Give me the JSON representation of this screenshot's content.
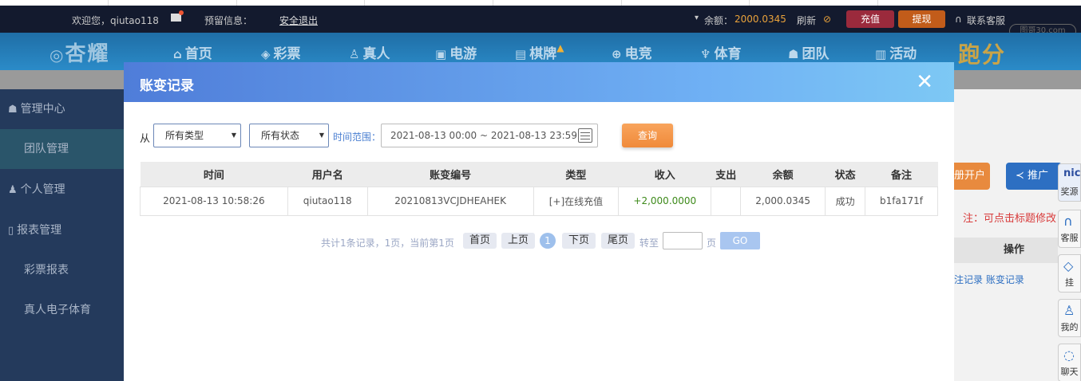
{
  "topbar": {
    "welcome": "欢迎您，qiutao118",
    "reserve_info": "预留信息：",
    "logout": "安全退出",
    "balance_label": "余额：",
    "balance_value": "2000.0345",
    "refresh": "刷新",
    "charge": "充值",
    "withdraw": "提现",
    "support": "联系客服",
    "watermark": "图哥30.com"
  },
  "nav": {
    "logo": "杏耀",
    "items": [
      "首页",
      "彩票",
      "真人",
      "电游",
      "棋牌",
      "电竞",
      "体育",
      "团队",
      "活动"
    ],
    "special": "跑分"
  },
  "sidebar": {
    "items": [
      {
        "label": "管理中心"
      },
      {
        "label": "团队管理"
      },
      {
        "label": "个人管理"
      },
      {
        "label": "报表管理"
      },
      {
        "label": "彩票报表"
      },
      {
        "label": "真人电子体育"
      }
    ]
  },
  "background_panel": {
    "open_account": "册开户",
    "promo": "推广",
    "note": "注：可点击标题修改",
    "op_header": "操作",
    "op_links": "注记录  账变记录",
    "float_items": [
      "奖源",
      "客服",
      "挂",
      "我的",
      "聊天"
    ]
  },
  "modal": {
    "title": "账变记录",
    "close": "✕",
    "filter": {
      "from_label": "从",
      "type_select": "所有类型",
      "status_select": "所有状态",
      "range_label": "时间范围：",
      "date_range": "2021-08-13 00:00 ~ 2021-08-13 23:59",
      "query_button": "查询"
    },
    "table": {
      "headers": [
        "时间",
        "用户名",
        "账变编号",
        "类型",
        "收入",
        "支出",
        "余额",
        "状态",
        "备注"
      ],
      "rows": [
        [
          "2021-08-13 10:58:26",
          "qiutao118",
          "20210813VCJDHEAHEK",
          "[+]在线充值",
          "+2,000.0000",
          "",
          "2,000.0345",
          "成功",
          "b1fa171f"
        ]
      ]
    },
    "pager": {
      "info": "共计1条记录，1页，当前第1页",
      "first": "首页",
      "prev": "上页",
      "current": "1",
      "next": "下页",
      "last": "尾页",
      "goto_label": "转至",
      "page_label": "页",
      "go": "GO"
    }
  },
  "colors": {
    "topbar_bg": "#131a2e",
    "nav_bg": "#2b8bc8",
    "sidebar_bg": "#243a5c",
    "modal_header_start": "#4f7dd9",
    "modal_header_end": "#7dc8f4",
    "query_button": "#f08a3a",
    "income_green": "#3d8a1a"
  }
}
